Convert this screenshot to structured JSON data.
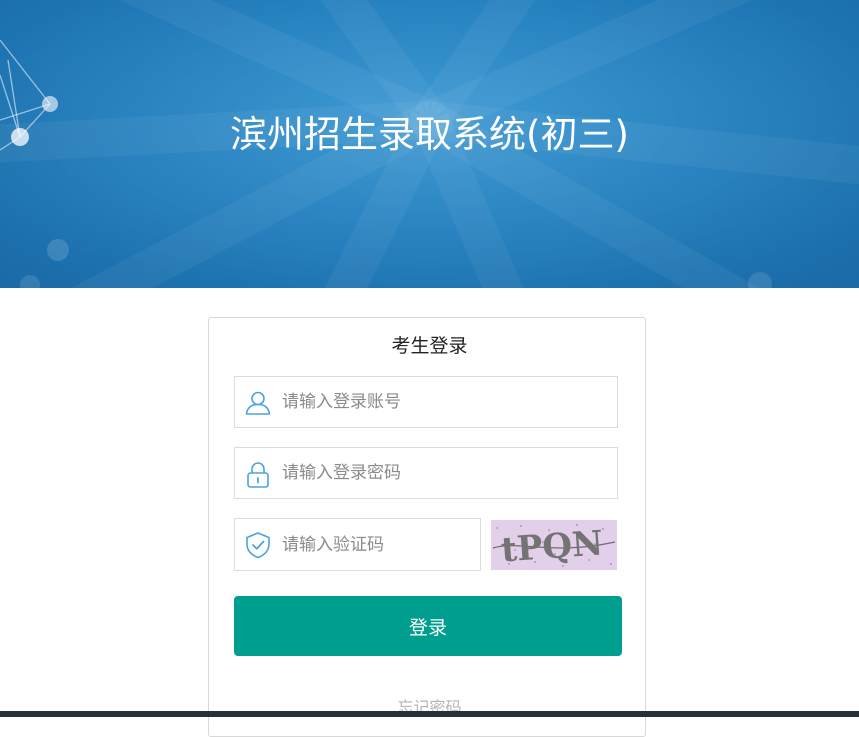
{
  "banner": {
    "title": "滨州招生录取系统(初三)"
  },
  "login": {
    "title": "考生登录",
    "account_placeholder": "请输入登录账号",
    "password_placeholder": "请输入登录密码",
    "captcha_placeholder": "请输入验证码",
    "captcha_text": "tPQN",
    "submit_label": "登录",
    "forgot_label": "忘记密码"
  },
  "colors": {
    "banner": "#217fbf",
    "button": "#009e8f",
    "icon": "#4aa3df",
    "captcha_bg": "#e2cfe9"
  }
}
